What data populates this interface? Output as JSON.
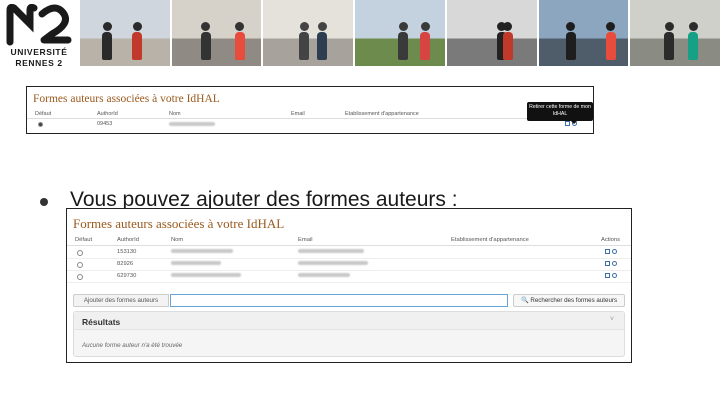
{
  "logo": {
    "line1": "UNIVERSITÉ",
    "line2": "RENNES 2",
    "color": "#1a1a1a"
  },
  "banner": {
    "photos": [
      {
        "sky": "#cfd6de",
        "ground": "#b9b2a8",
        "figure": "#2a2a2a",
        "accent": "#c0392b"
      },
      {
        "sky": "#d7d2c9",
        "ground": "#8f8a84",
        "figure": "#333333",
        "accent": "#e74c3c"
      },
      {
        "sky": "#e5e2dc",
        "ground": "#a7a39c",
        "figure": "#444444",
        "accent": "#2c3e50"
      },
      {
        "sky": "#c4d2e0",
        "ground": "#6e8b4e",
        "figure": "#3a3a3a",
        "accent": "#d64541"
      },
      {
        "sky": "#d8d8d8",
        "ground": "#7a7a7a",
        "figure": "#222222",
        "accent": "#c0392b"
      },
      {
        "sky": "#8da6bf",
        "ground": "#4f5d6a",
        "figure": "#1e1e1e",
        "accent": "#e74c3c"
      },
      {
        "sky": "#cfd0c9",
        "ground": "#8a8c83",
        "figure": "#2b2b2b",
        "accent": "#16a085"
      }
    ]
  },
  "panel1": {
    "title": "Formes auteurs associées à votre IdHAL",
    "headers": {
      "default": "Défaut",
      "authorid": "AuthorId",
      "name": "Nom",
      "email": "Email",
      "affiliation": "Etablissement d'appartenance"
    },
    "row": {
      "authorid": "09453"
    },
    "tooltip": "Retirer cette forme de mon IdHAL"
  },
  "bullet": {
    "text": "Vous pouvez ajouter des formes auteurs :"
  },
  "panel2": {
    "title": "Formes auteurs associées à votre IdHAL",
    "headers": {
      "default": "Défaut",
      "authorid": "AuthorId",
      "name": "Nom",
      "email": "Email",
      "affiliation": "Etablissement d'appartenance",
      "actions": "Actions"
    },
    "rows": [
      {
        "authorid": "153130"
      },
      {
        "authorid": "82926"
      },
      {
        "authorid": "629730"
      }
    ],
    "add_label": "Ajouter des formes auteurs",
    "add_input_value": "",
    "search_label": "Rechercher des formes auteurs",
    "results_title": "Résultats",
    "results_toggle": "˅",
    "results_empty": "Aucune forme auteur n'a été trouvée"
  },
  "colors": {
    "title": "#9a5a1e",
    "accent": "#66a3d8",
    "icons": "#3b6ea8"
  }
}
